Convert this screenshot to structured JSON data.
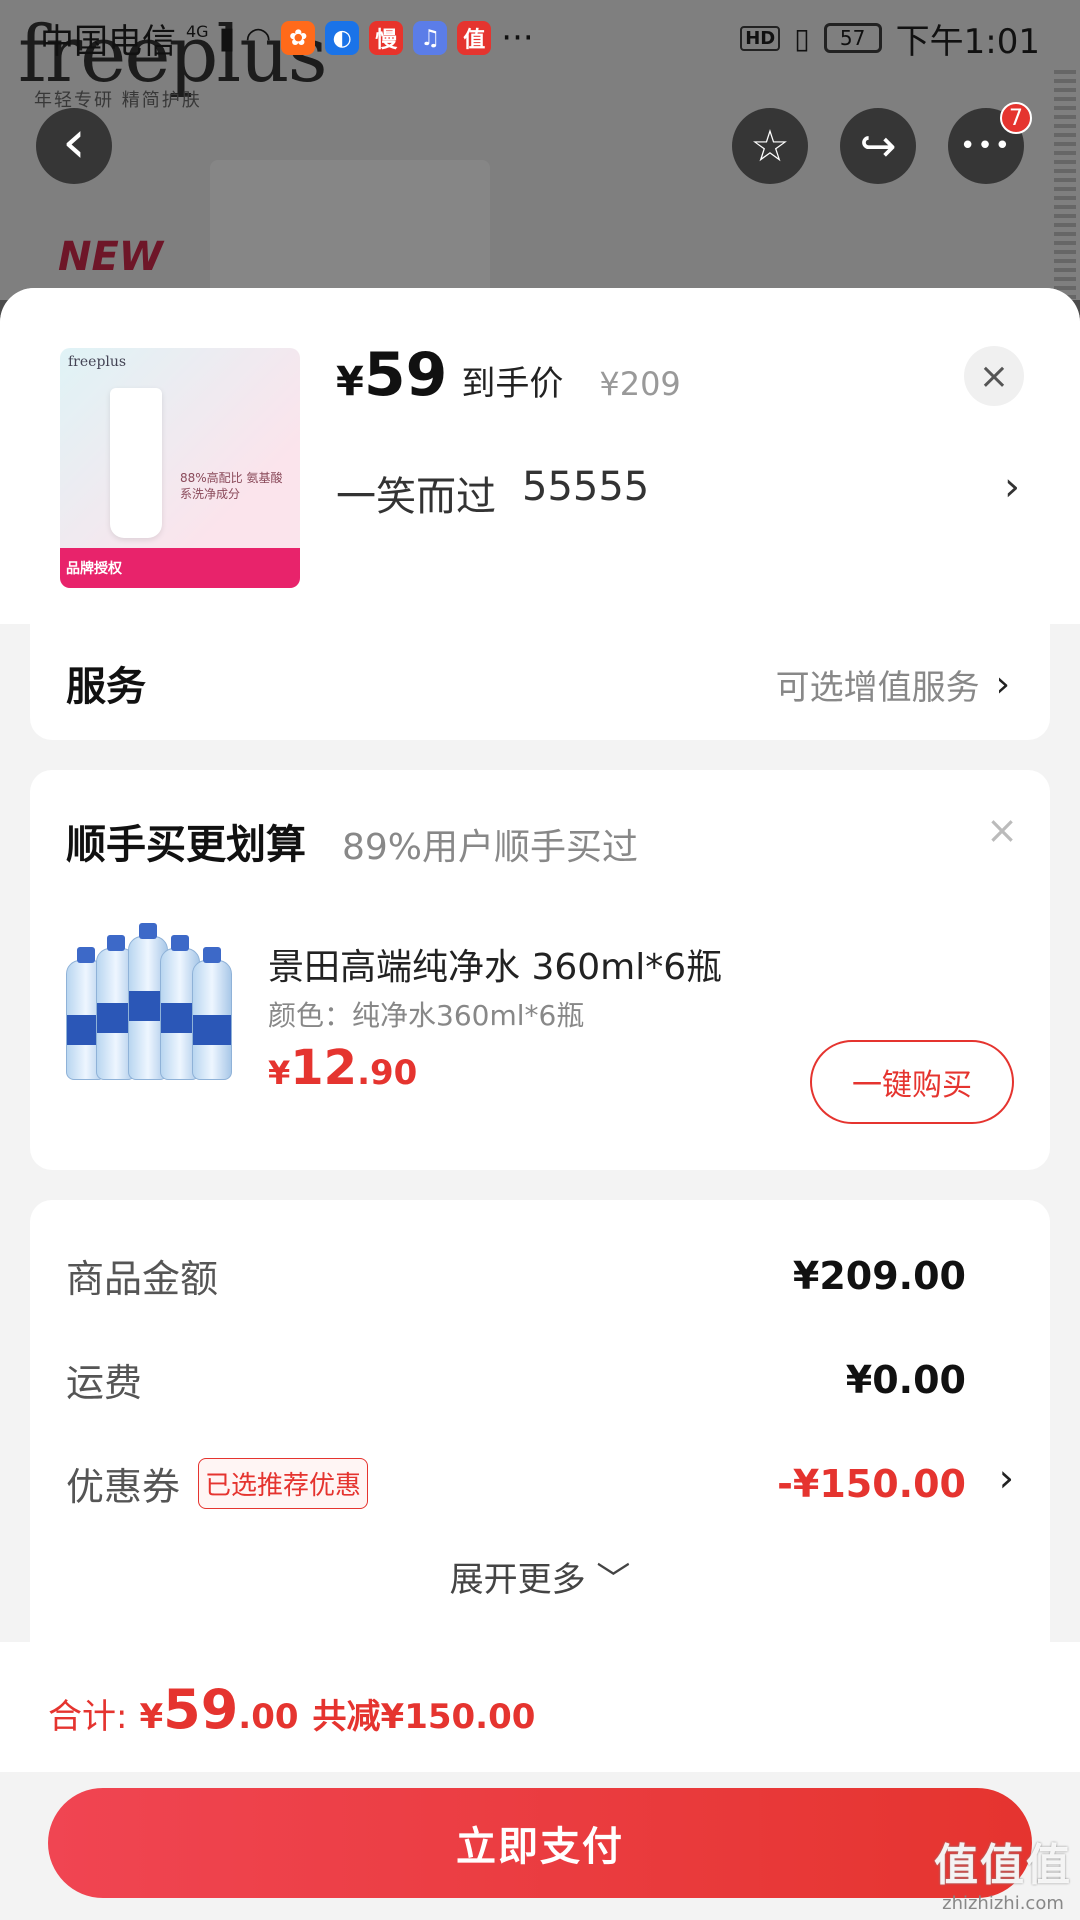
{
  "status_bar": {
    "carrier": "中国电信",
    "network": "4G",
    "app_icons": [
      {
        "name": "app-orange-icon",
        "glyph": "✿",
        "color": "#ff6a1a"
      },
      {
        "name": "app-browser-icon",
        "glyph": "◐",
        "color": "#1a73e8"
      },
      {
        "name": "app-man-icon",
        "glyph": "慢",
        "color": "#e8332b"
      },
      {
        "name": "app-music-icon",
        "glyph": "♫",
        "color": "#5b7de8"
      },
      {
        "name": "app-zhi-icon",
        "glyph": "值",
        "color": "#e5342f"
      }
    ],
    "more": "···",
    "hd": "HD",
    "battery": "57",
    "time": "下午1:01"
  },
  "background": {
    "brand": "freeplus",
    "brand_sub": "年轻专研 精简护肤",
    "new_tag": "NEW"
  },
  "nav": {
    "back_icon": "‹",
    "fav_icon": "☆",
    "share_icon": "↪",
    "more_icon": "•••",
    "badge": "7"
  },
  "product": {
    "image_logo": "freeplus",
    "image_text": "88%高配比 氨基酸系洗净成分",
    "image_strip": "品牌授权",
    "price_yen": "¥",
    "price": "59",
    "price_label": "到手价",
    "original_price": "¥209",
    "close_icon": "×",
    "spec_name": "一笑而过",
    "spec_value": "55555",
    "spec_chevron": "›"
  },
  "service": {
    "title": "服务",
    "hint": "可选增值服务",
    "chevron": "›"
  },
  "addon": {
    "title": "顺手买更划算",
    "subtitle": "89%用户顺手买过",
    "close_icon": "×",
    "item_name": "景田高端纯净水 360ml*6瓶",
    "item_spec": "颜色：纯净水360ml*6瓶",
    "price_yen": "¥",
    "price_int": "12",
    "price_dec": ".90",
    "buy_button": "一键购买"
  },
  "summary": {
    "rows": [
      {
        "label": "商品金额",
        "value": "¥209.00"
      },
      {
        "label": "运费",
        "value": "¥0.00"
      },
      {
        "label": "优惠券",
        "tag": "已选推荐优惠",
        "value": "-¥150.00",
        "chevron": "›"
      }
    ],
    "expand": "展开更多 ﹀"
  },
  "total": {
    "label": "合计:",
    "yen": "¥",
    "int": "59",
    "dec": ".00",
    "saved": "共减¥150.00"
  },
  "pay_button": "立即支付",
  "watermark": {
    "big": "值值值",
    "small": "zhizhizhi.com"
  },
  "colors": {
    "accent": "#e5342f",
    "sheet_bg": "#f3f3f3"
  }
}
